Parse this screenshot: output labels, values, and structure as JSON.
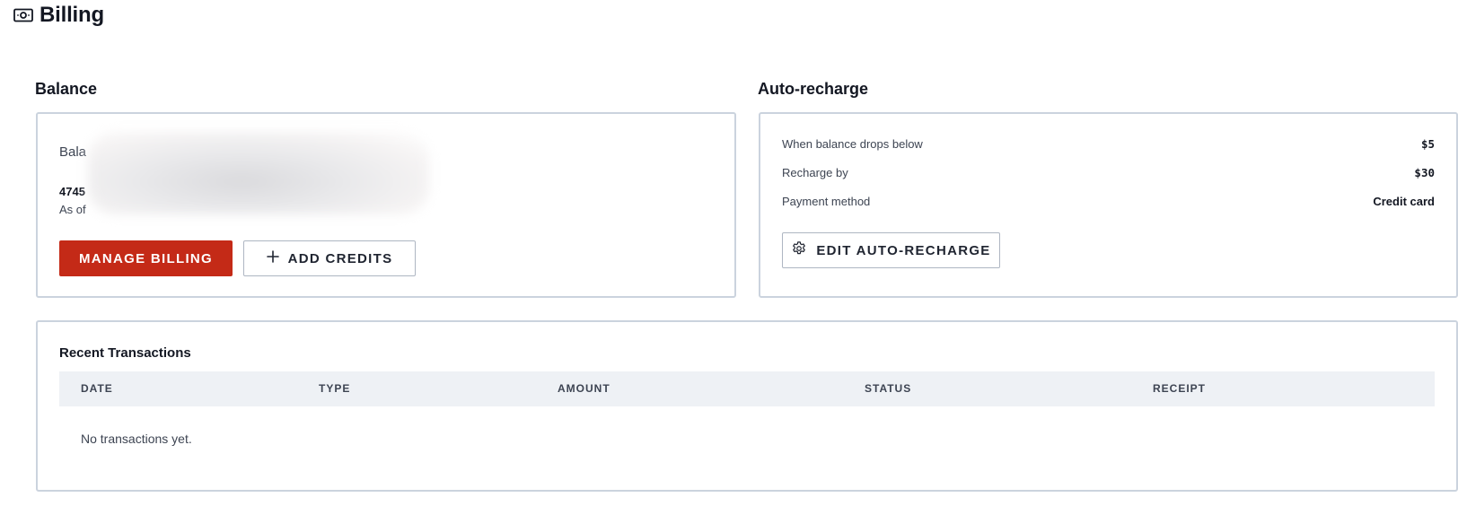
{
  "header": {
    "title": "Billing",
    "icon": "banknote-icon"
  },
  "balance": {
    "section_label": "Balance",
    "label": "Bala",
    "value": "4745",
    "as_of": "As of"
  },
  "billing_actions": {
    "manage_label": "MANAGE BILLING",
    "add_credits_label": "ADD CREDITS",
    "add_icon": "plus-icon"
  },
  "auto_recharge": {
    "section_label": "Auto-recharge",
    "rows": [
      {
        "label": "When balance drops below",
        "value": "$5"
      },
      {
        "label": "Recharge by",
        "value": "$30"
      },
      {
        "label": "Payment method",
        "value": "Credit card"
      }
    ],
    "edit_label": "EDIT AUTO-RECHARGE",
    "edit_icon": "gear-icon"
  },
  "transactions": {
    "title": "Recent Transactions",
    "columns": [
      "DATE",
      "TYPE",
      "AMOUNT",
      "STATUS",
      "RECEIPT"
    ],
    "empty_text": "No transactions yet."
  },
  "colors": {
    "primary": "#c42a17",
    "border": "#cbd3de",
    "table_header_bg": "#eef1f5",
    "text": "#131722"
  }
}
